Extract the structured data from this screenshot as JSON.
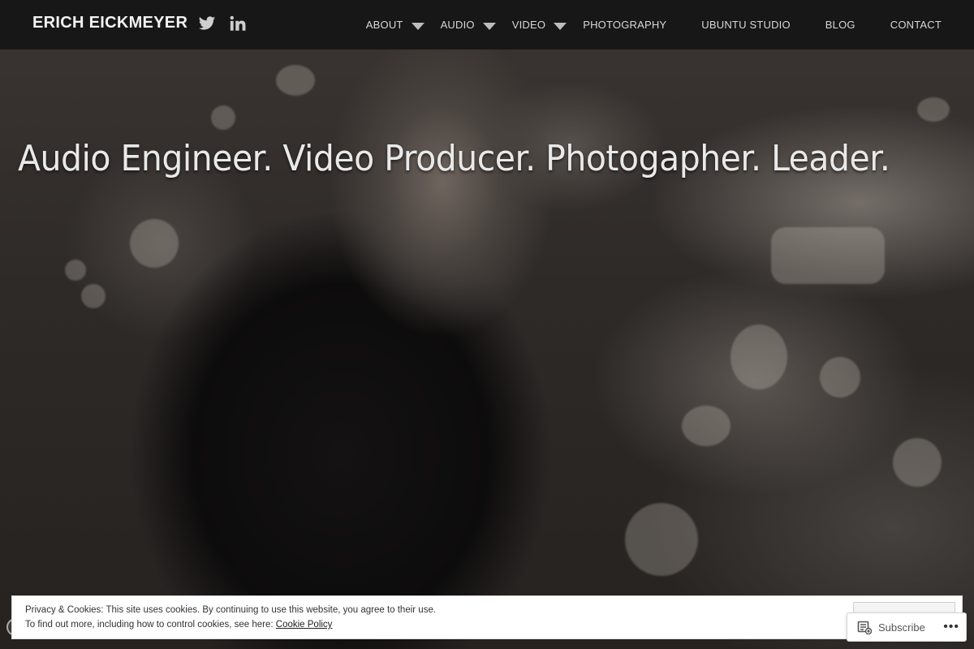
{
  "site": {
    "title": "ERICH EICKMEYER",
    "tagline": "Audio Engineer. Video Producer. Photogapher. Leader."
  },
  "social": [
    {
      "icon": "twitter-icon"
    },
    {
      "icon": "linkedin-icon"
    }
  ],
  "nav": {
    "about": "ABOUT",
    "audio": "AUDIO",
    "video": "VIDEO",
    "photography": "PHOTOGRAPHY",
    "ubuntu_studio": "UBUNTU STUDIO",
    "blog": "BLOG",
    "contact": "CONTACT"
  },
  "cookie": {
    "line1": "Privacy & Cookies: This site uses cookies. By continuing to use this website, you agree to their use.",
    "line2_prefix": "To find out more, including how to control cookies, see here: ",
    "policy_link": "Cookie Policy"
  },
  "subscribe": {
    "label": "Subscribe",
    "more": "•••"
  },
  "colors": {
    "header_bg": "#161616",
    "text_light": "#e9e9e9",
    "nav_text": "#d8d8d8"
  }
}
